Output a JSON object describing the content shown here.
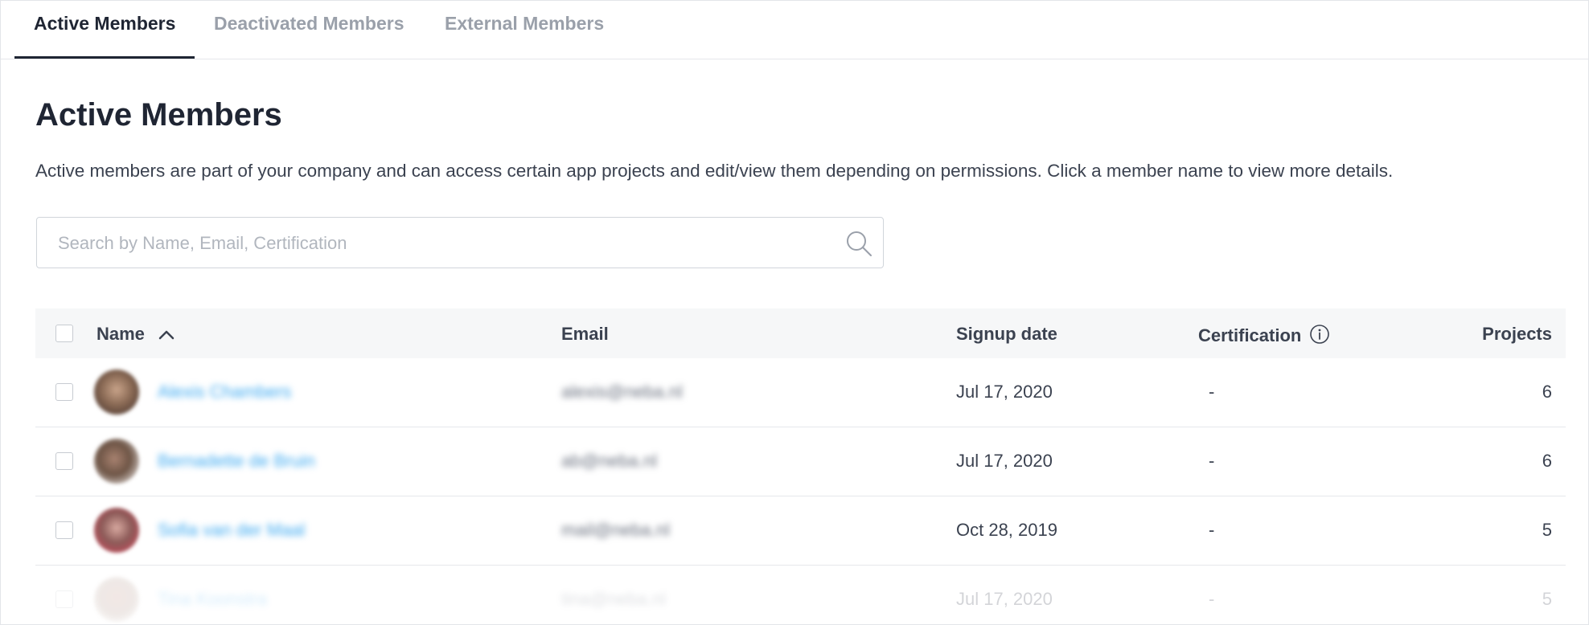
{
  "tabs": [
    {
      "label": "Active Members",
      "active": true
    },
    {
      "label": "Deactivated Members",
      "active": false
    },
    {
      "label": "External Members",
      "active": false
    }
  ],
  "page": {
    "title": "Active Members",
    "description": "Active members are part of your company and can access certain app projects and edit/view them depending on permissions. Click a member name to view more details."
  },
  "search": {
    "placeholder": "Search by Name, Email, Certification",
    "value": "",
    "icon": "search-icon"
  },
  "table": {
    "columns": {
      "name": "Name",
      "email": "Email",
      "signup": "Signup date",
      "certification": "Certification",
      "projects": "Projects"
    },
    "sort": {
      "column": "name",
      "direction": "ascending",
      "icon": "chevron-up-icon"
    },
    "rows": [
      {
        "name": "Alexis Chambers",
        "email": "alexis@neba.nl",
        "signup": "Jul 17, 2020",
        "certification": "-",
        "projects": "6",
        "avatar_color": "#8a6a55"
      },
      {
        "name": "Bernadette de Bruin",
        "email": "ab@neba.nl",
        "signup": "Jul 17, 2020",
        "certification": "-",
        "projects": "6",
        "avatar_color": "#6e5546"
      },
      {
        "name": "Sofia van der Maal",
        "email": "mail@neba.nl",
        "signup": "Oct 28, 2019",
        "certification": "-",
        "projects": "5",
        "avatar_color": "#8c5a58"
      },
      {
        "name": "Tina Koonstra",
        "email": "tina@neba.nl",
        "signup": "Jul 17, 2020",
        "certification": "-",
        "projects": "5",
        "avatar_color": "#b59c90"
      }
    ]
  },
  "colors": {
    "link": "#3da9f0",
    "text": "#1f2533",
    "muted": "#9aa0aa",
    "header_bg": "#f6f7f8"
  }
}
